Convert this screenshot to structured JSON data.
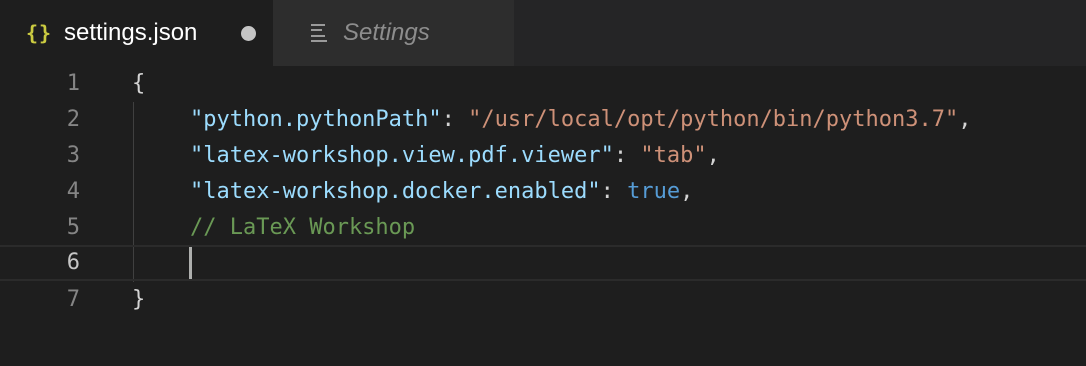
{
  "tabs": {
    "active": {
      "icon": "json-braces-icon",
      "icon_glyph": "{}",
      "title": "settings.json",
      "dirty_indicator": "unsaved-dot-icon"
    },
    "inactive": {
      "icon": "settings-list-icon",
      "title": "Settings"
    }
  },
  "editor": {
    "line_numbers": [
      "1",
      "2",
      "3",
      "4",
      "5",
      "6",
      "7"
    ],
    "current_line": 6,
    "lines": {
      "l1": {
        "open_brace": "{"
      },
      "l2": {
        "key": "\"python.pythonPath\"",
        "colon": ": ",
        "value": "\"/usr/local/opt/python/bin/python3.7\"",
        "comma": ","
      },
      "l3": {
        "key": "\"latex-workshop.view.pdf.viewer\"",
        "colon": ": ",
        "value": "\"tab\"",
        "comma": ","
      },
      "l4": {
        "key": "\"latex-workshop.docker.enabled\"",
        "colon": ": ",
        "value": "true",
        "comma": ","
      },
      "l5": {
        "comment": "// LaTeX Workshop"
      },
      "l6": {
        "text": ""
      },
      "l7": {
        "close_brace": "}"
      }
    }
  },
  "colors": {
    "background": "#1e1e1e",
    "key": "#9cdcfe",
    "string": "#ce9178",
    "boolean": "#569cd6",
    "comment": "#6a9955",
    "json_icon": "#cbcb41"
  }
}
